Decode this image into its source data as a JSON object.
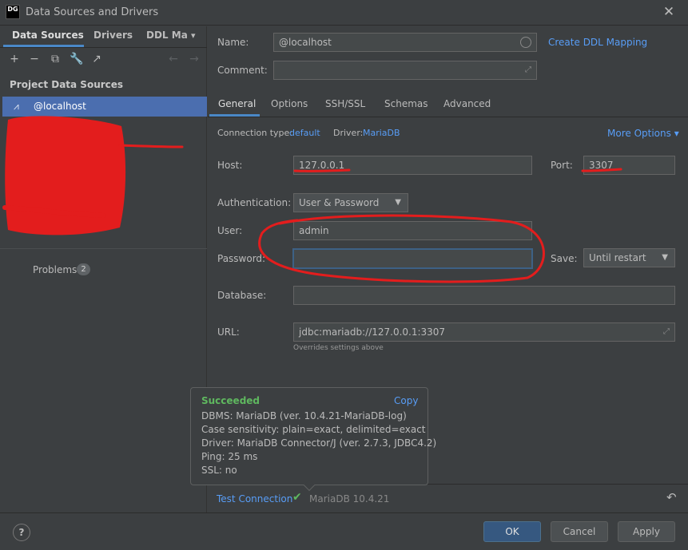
{
  "window": {
    "title": "Data Sources and Drivers",
    "app_icon": "DG"
  },
  "left_tabs": [
    "Data Sources",
    "Drivers",
    "DDL Ma"
  ],
  "sidebar": {
    "section_title": "Project Data Sources",
    "selected_item": "@localhost",
    "problems_label": "Problems",
    "problems_count": "2"
  },
  "form": {
    "name_label": "Name:",
    "name_value": "@localhost",
    "create_ddl_link": "Create DDL Mapping",
    "comment_label": "Comment:",
    "tabs": [
      "General",
      "Options",
      "SSH/SSL",
      "Schemas",
      "Advanced"
    ],
    "connection_type_label": "Connection type:",
    "connection_type_value": "default",
    "driver_label": "Driver:",
    "driver_value": "MariaDB",
    "more_options": "More Options",
    "host_label": "Host:",
    "host_value": "127.0.0.1",
    "port_label": "Port:",
    "port_value": "3307",
    "auth_label": "Authentication:",
    "auth_value": "User & Password",
    "user_label": "User:",
    "user_value": "admin",
    "password_label": "Password:",
    "password_value": "",
    "save_label": "Save:",
    "save_value": "Until restart",
    "database_label": "Database:",
    "database_value": "",
    "url_label": "URL:",
    "url_value": "jdbc:mariadb://127.0.0.1:3307",
    "url_hint": "Overrides settings above"
  },
  "popup": {
    "title": "Succeeded",
    "copy_label": "Copy",
    "lines": [
      "DBMS: MariaDB (ver. 10.4.21-MariaDB-log)",
      "Case sensitivity: plain=exact, delimited=exact",
      "Driver: MariaDB Connector/J (ver. 2.7.3, JDBC4.2)",
      "Ping: 25 ms",
      "SSL: no"
    ]
  },
  "status": {
    "test_connection": "Test Connection",
    "db_version": "MariaDB 10.4.21"
  },
  "buttons": {
    "help": "?",
    "ok": "OK",
    "cancel": "Cancel",
    "apply": "Apply"
  },
  "colors": {
    "accent": "#589df6",
    "selection": "#4b6eaf",
    "success": "#5fb85f",
    "annotation": "#e31d1d"
  }
}
